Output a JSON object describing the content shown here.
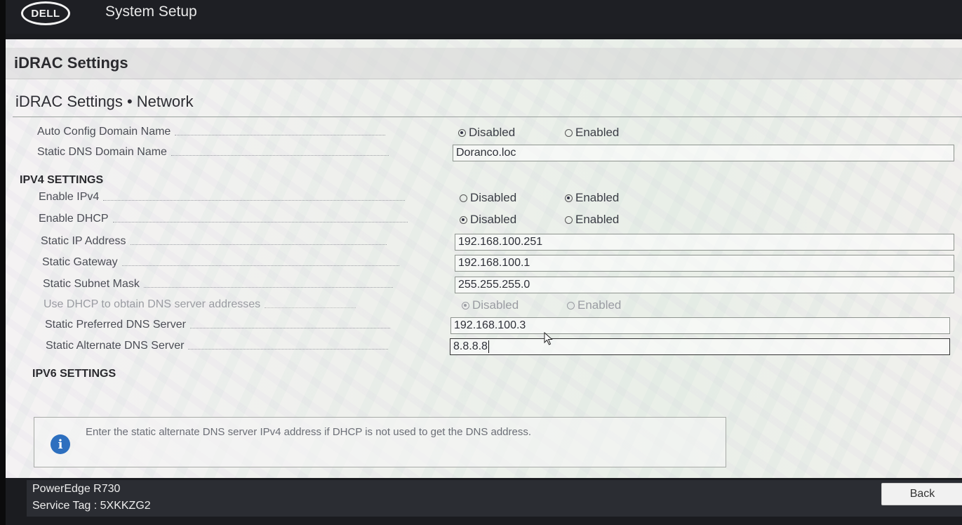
{
  "app": {
    "logo_text": "DELL",
    "title": "System Setup"
  },
  "section": {
    "title": "iDRAC Settings",
    "subtitle": "iDRAC Settings • Network"
  },
  "fields": {
    "auto_config_domain": {
      "label": "Auto Config Domain Name",
      "options": [
        "Disabled",
        "Enabled"
      ],
      "selected": "Disabled"
    },
    "static_dns_domain": {
      "label": "Static DNS Domain Name",
      "value": "Doranco.loc"
    }
  },
  "ipv4": {
    "heading": "IPV4 SETTINGS",
    "enable_ipv4": {
      "label": "Enable IPv4",
      "options": [
        "Disabled",
        "Enabled"
      ],
      "selected": "Enabled"
    },
    "enable_dhcp": {
      "label": "Enable DHCP",
      "options": [
        "Disabled",
        "Enabled"
      ],
      "selected": "Disabled"
    },
    "static_ip": {
      "label": "Static IP Address",
      "value": "192.168.100.251"
    },
    "static_gateway": {
      "label": "Static Gateway",
      "value": "192.168.100.1"
    },
    "static_subnet": {
      "label": "Static Subnet Mask",
      "value": "255.255.255.0"
    },
    "dhcp_dns": {
      "label": "Use DHCP to obtain DNS server addresses",
      "options": [
        "Disabled",
        "Enabled"
      ],
      "selected": "Disabled",
      "disabled": true
    },
    "preferred_dns": {
      "label": "Static Preferred DNS Server",
      "value": "192.168.100.3"
    },
    "alternate_dns": {
      "label": "Static Alternate DNS Server",
      "value": "8.8.8.8"
    }
  },
  "ipv6": {
    "heading": "IPV6 SETTINGS"
  },
  "help": {
    "text": "Enter the static alternate DNS server IPv4 address if DHCP is not used to get the DNS address."
  },
  "footer": {
    "model": "PowerEdge R730",
    "service_tag": "Service Tag : 5XKKZG2",
    "back_label": "Back"
  }
}
